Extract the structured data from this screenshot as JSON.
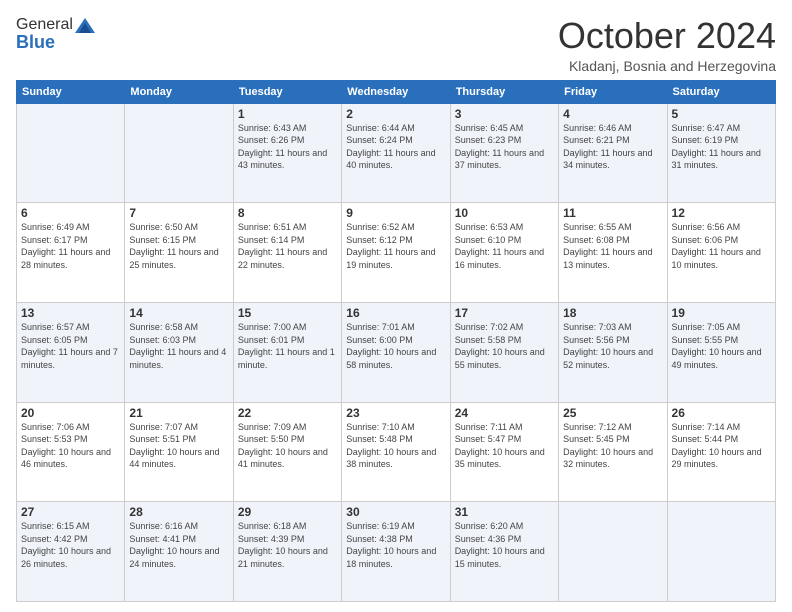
{
  "header": {
    "logo_general": "General",
    "logo_blue": "Blue",
    "month_title": "October 2024",
    "location": "Kladanj, Bosnia and Herzegovina"
  },
  "weekdays": [
    "Sunday",
    "Monday",
    "Tuesday",
    "Wednesday",
    "Thursday",
    "Friday",
    "Saturday"
  ],
  "weeks": [
    [
      {
        "day": "",
        "info": ""
      },
      {
        "day": "",
        "info": ""
      },
      {
        "day": "1",
        "info": "Sunrise: 6:43 AM\nSunset: 6:26 PM\nDaylight: 11 hours and 43 minutes."
      },
      {
        "day": "2",
        "info": "Sunrise: 6:44 AM\nSunset: 6:24 PM\nDaylight: 11 hours and 40 minutes."
      },
      {
        "day": "3",
        "info": "Sunrise: 6:45 AM\nSunset: 6:23 PM\nDaylight: 11 hours and 37 minutes."
      },
      {
        "day": "4",
        "info": "Sunrise: 6:46 AM\nSunset: 6:21 PM\nDaylight: 11 hours and 34 minutes."
      },
      {
        "day": "5",
        "info": "Sunrise: 6:47 AM\nSunset: 6:19 PM\nDaylight: 11 hours and 31 minutes."
      }
    ],
    [
      {
        "day": "6",
        "info": "Sunrise: 6:49 AM\nSunset: 6:17 PM\nDaylight: 11 hours and 28 minutes."
      },
      {
        "day": "7",
        "info": "Sunrise: 6:50 AM\nSunset: 6:15 PM\nDaylight: 11 hours and 25 minutes."
      },
      {
        "day": "8",
        "info": "Sunrise: 6:51 AM\nSunset: 6:14 PM\nDaylight: 11 hours and 22 minutes."
      },
      {
        "day": "9",
        "info": "Sunrise: 6:52 AM\nSunset: 6:12 PM\nDaylight: 11 hours and 19 minutes."
      },
      {
        "day": "10",
        "info": "Sunrise: 6:53 AM\nSunset: 6:10 PM\nDaylight: 11 hours and 16 minutes."
      },
      {
        "day": "11",
        "info": "Sunrise: 6:55 AM\nSunset: 6:08 PM\nDaylight: 11 hours and 13 minutes."
      },
      {
        "day": "12",
        "info": "Sunrise: 6:56 AM\nSunset: 6:06 PM\nDaylight: 11 hours and 10 minutes."
      }
    ],
    [
      {
        "day": "13",
        "info": "Sunrise: 6:57 AM\nSunset: 6:05 PM\nDaylight: 11 hours and 7 minutes."
      },
      {
        "day": "14",
        "info": "Sunrise: 6:58 AM\nSunset: 6:03 PM\nDaylight: 11 hours and 4 minutes."
      },
      {
        "day": "15",
        "info": "Sunrise: 7:00 AM\nSunset: 6:01 PM\nDaylight: 11 hours and 1 minute."
      },
      {
        "day": "16",
        "info": "Sunrise: 7:01 AM\nSunset: 6:00 PM\nDaylight: 10 hours and 58 minutes."
      },
      {
        "day": "17",
        "info": "Sunrise: 7:02 AM\nSunset: 5:58 PM\nDaylight: 10 hours and 55 minutes."
      },
      {
        "day": "18",
        "info": "Sunrise: 7:03 AM\nSunset: 5:56 PM\nDaylight: 10 hours and 52 minutes."
      },
      {
        "day": "19",
        "info": "Sunrise: 7:05 AM\nSunset: 5:55 PM\nDaylight: 10 hours and 49 minutes."
      }
    ],
    [
      {
        "day": "20",
        "info": "Sunrise: 7:06 AM\nSunset: 5:53 PM\nDaylight: 10 hours and 46 minutes."
      },
      {
        "day": "21",
        "info": "Sunrise: 7:07 AM\nSunset: 5:51 PM\nDaylight: 10 hours and 44 minutes."
      },
      {
        "day": "22",
        "info": "Sunrise: 7:09 AM\nSunset: 5:50 PM\nDaylight: 10 hours and 41 minutes."
      },
      {
        "day": "23",
        "info": "Sunrise: 7:10 AM\nSunset: 5:48 PM\nDaylight: 10 hours and 38 minutes."
      },
      {
        "day": "24",
        "info": "Sunrise: 7:11 AM\nSunset: 5:47 PM\nDaylight: 10 hours and 35 minutes."
      },
      {
        "day": "25",
        "info": "Sunrise: 7:12 AM\nSunset: 5:45 PM\nDaylight: 10 hours and 32 minutes."
      },
      {
        "day": "26",
        "info": "Sunrise: 7:14 AM\nSunset: 5:44 PM\nDaylight: 10 hours and 29 minutes."
      }
    ],
    [
      {
        "day": "27",
        "info": "Sunrise: 6:15 AM\nSunset: 4:42 PM\nDaylight: 10 hours and 26 minutes."
      },
      {
        "day": "28",
        "info": "Sunrise: 6:16 AM\nSunset: 4:41 PM\nDaylight: 10 hours and 24 minutes."
      },
      {
        "day": "29",
        "info": "Sunrise: 6:18 AM\nSunset: 4:39 PM\nDaylight: 10 hours and 21 minutes."
      },
      {
        "day": "30",
        "info": "Sunrise: 6:19 AM\nSunset: 4:38 PM\nDaylight: 10 hours and 18 minutes."
      },
      {
        "day": "31",
        "info": "Sunrise: 6:20 AM\nSunset: 4:36 PM\nDaylight: 10 hours and 15 minutes."
      },
      {
        "day": "",
        "info": ""
      },
      {
        "day": "",
        "info": ""
      }
    ]
  ]
}
